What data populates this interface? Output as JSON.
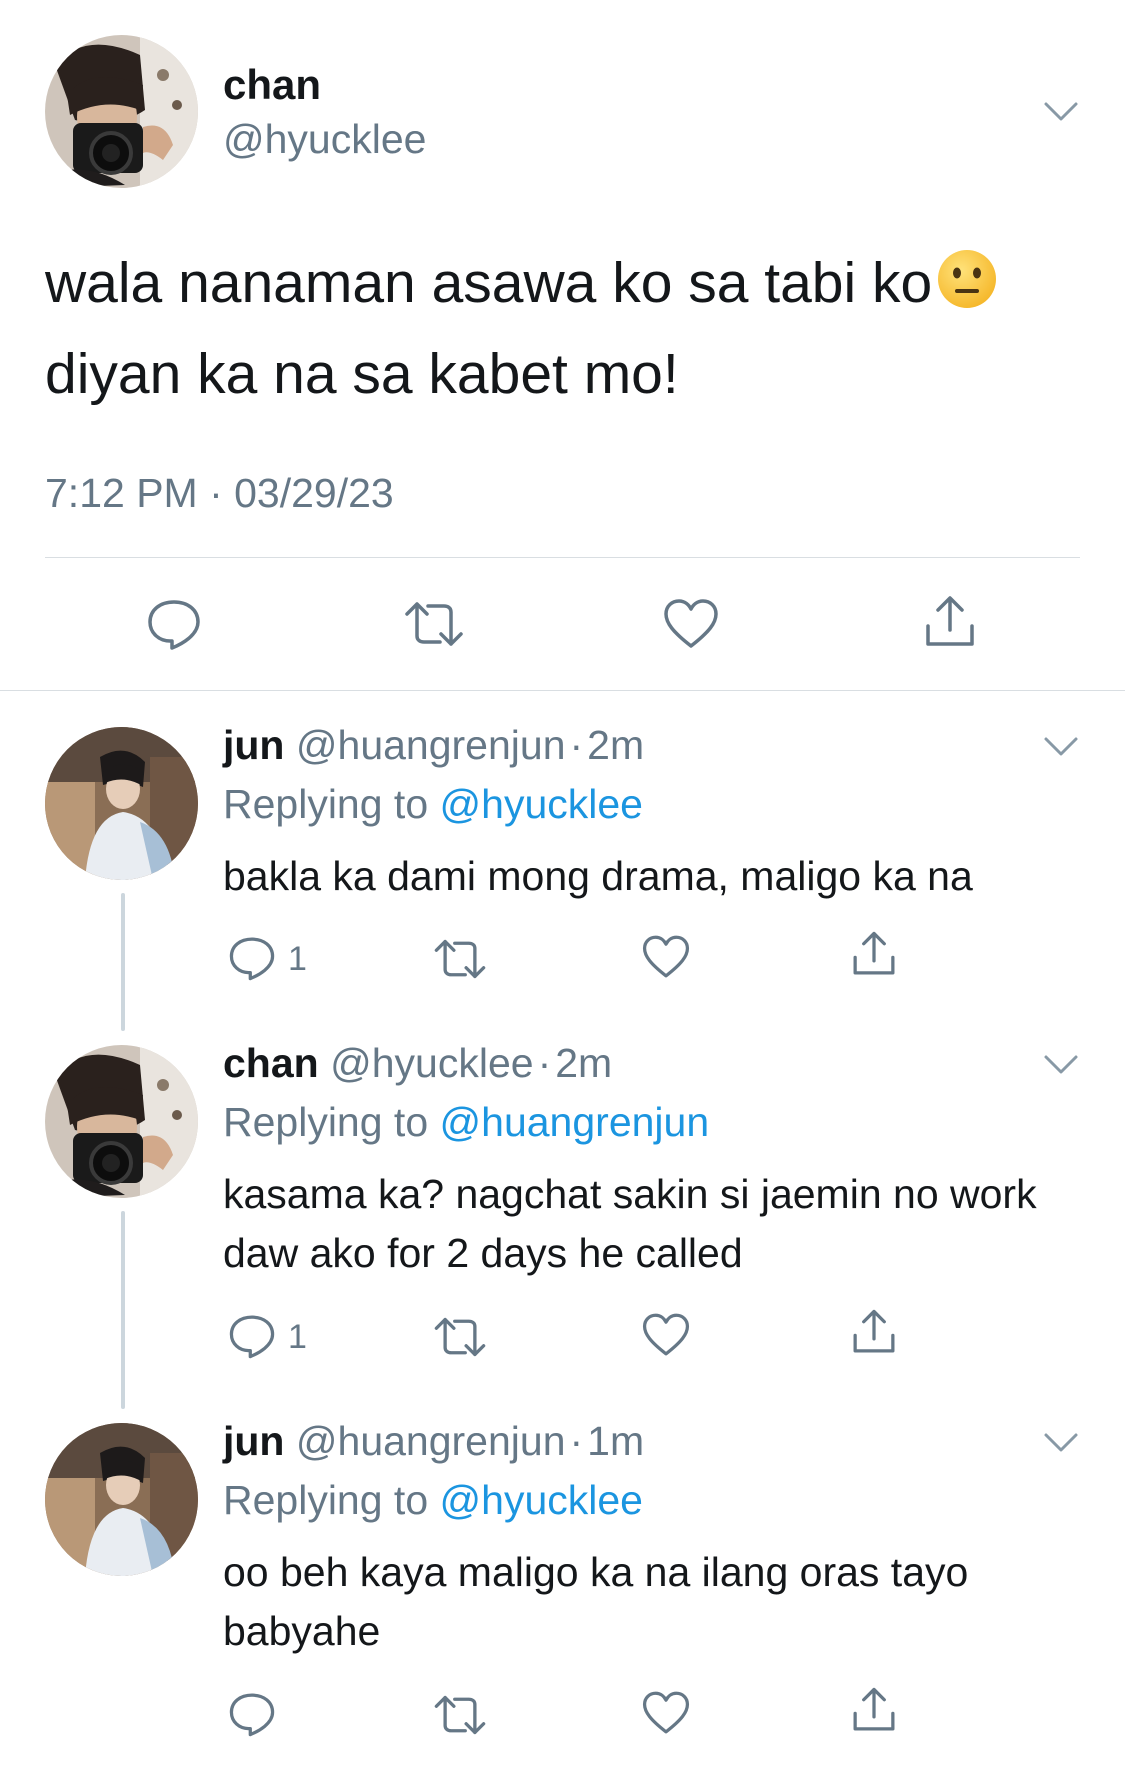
{
  "main_tweet": {
    "name": "chan",
    "handle": "@hyucklee",
    "text_line1": "wala nanaman asawa ko sa tabi ko",
    "text_line2": "diyan ka na sa kabet mo!",
    "timestamp": "7:12 PM · 03/29/23",
    "emoji": "neutral-face-emoji"
  },
  "icons": {
    "reply": "reply-icon",
    "retweet": "retweet-icon",
    "like": "like-icon",
    "share": "share-icon",
    "more": "chevron-down-icon"
  },
  "colors": {
    "text": "#14171a",
    "muted": "#657786",
    "link": "#1b95e0",
    "divider": "#d9dee2"
  },
  "replies": [
    {
      "name": "jun",
      "handle": "@huangrenjun",
      "dot": "·",
      "time": "2m",
      "replying_label": "Replying to",
      "replying_handle": "@hyucklee",
      "text": "bakla ka dami mong drama, maligo ka na",
      "reply_count": "1"
    },
    {
      "name": "chan",
      "handle": "@hyucklee",
      "dot": "·",
      "time": "2m",
      "replying_label": "Replying to",
      "replying_handle": "@huangrenjun",
      "text": "kasama ka? nagchat sakin si jaemin no work daw ako for 2 days he called",
      "reply_count": "1"
    },
    {
      "name": "jun",
      "handle": "@huangrenjun",
      "dot": "·",
      "time": "1m",
      "replying_label": "Replying to",
      "replying_handle": "@hyucklee",
      "text": "oo beh kaya maligo ka na ilang oras tayo babyahe",
      "reply_count": ""
    }
  ]
}
